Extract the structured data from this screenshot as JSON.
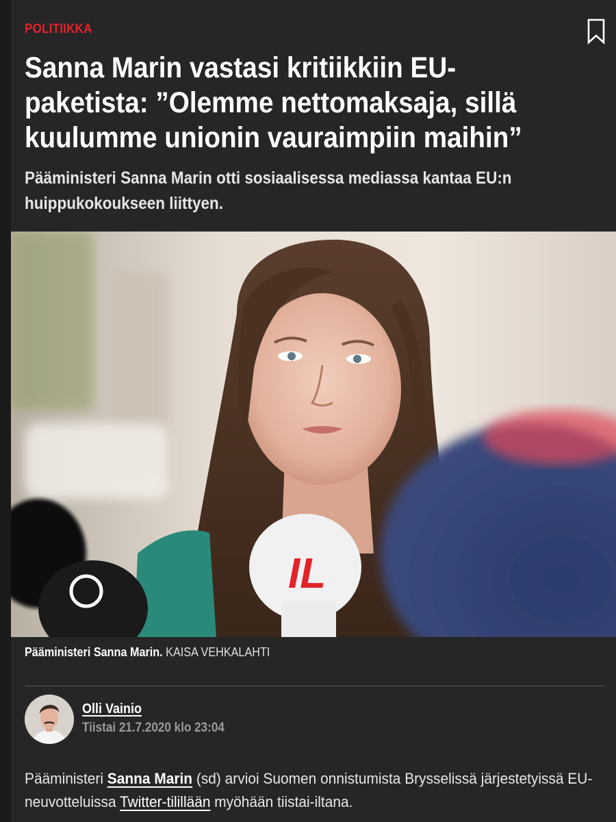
{
  "article": {
    "category": "POLITIIKKA",
    "headline": "Sanna Marin vastasi kritiikkiin EU-paketista: ”Olemme nettomaksaja, sillä kuulumme unionin vauraimpiin maihin”",
    "lead": "Pääministeri Sanna Marin otti sosiaalisessa mediassa kantaa EU:n huippukokoukseen liittyen.",
    "photo": {
      "caption": "Pääministeri Sanna Marin.",
      "credit": "KAISA VEHKALAHTI",
      "microphone_logo": "IL"
    },
    "author": {
      "name": "Olli Vainio",
      "date": "Tiistai 21.7.2020 klo 23:04"
    },
    "body": {
      "p1_part1": "Pääministeri ",
      "p1_link_person": "Sanna Marin",
      "p1_part2": " (sd) arvioi Suomen onnistumista Brysselissä järjestetyissä EU-neuvotteluissa ",
      "p1_link_twitter": "Twitter-tilillään",
      "p1_part3": " myöhään tiistai-iltana."
    }
  },
  "icons": {
    "bookmark": "bookmark-icon"
  },
  "colors": {
    "accent": "#e3222a",
    "background": "#262626",
    "text": "#ffffff",
    "muted": "#9a9a9a"
  }
}
